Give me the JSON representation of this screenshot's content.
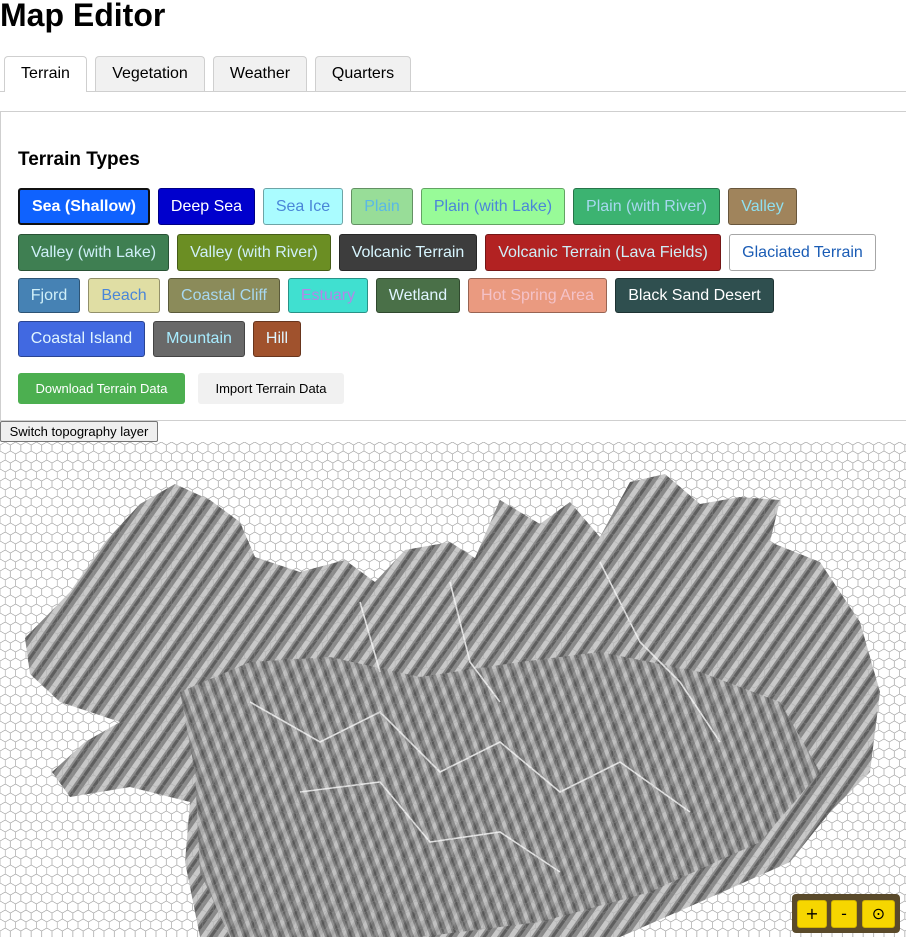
{
  "page": {
    "title": "Map Editor"
  },
  "tabs": [
    "Terrain",
    "Vegetation",
    "Weather",
    "Quarters"
  ],
  "section": {
    "title": "Terrain Types"
  },
  "terrain_types": [
    {
      "label": "Sea (Shallow)",
      "bg": "#0f62fe",
      "fg": "#ffffff",
      "selected": true
    },
    {
      "label": "Deep Sea",
      "bg": "#0000cd",
      "fg": "#ffffff"
    },
    {
      "label": "Sea Ice",
      "bg": "#aafcff",
      "fg": "#4a86d8"
    },
    {
      "label": "Plain",
      "bg": "#98dd98",
      "fg": "#5ab8e6"
    },
    {
      "label": "Plain (with Lake)",
      "bg": "#98fb98",
      "fg": "#4a86d8"
    },
    {
      "label": "Plain (with River)",
      "bg": "#3cb371",
      "fg": "#a8d8f0"
    },
    {
      "label": "Valley",
      "bg": "#a0845c",
      "fg": "#8fe0f0"
    },
    {
      "label": "Valley (with Lake)",
      "bg": "#3f7f52",
      "fg": "#cfeff8"
    },
    {
      "label": "Valley (with River)",
      "bg": "#6b8e23",
      "fg": "#cfeff8"
    },
    {
      "label": "Volcanic Terrain",
      "bg": "#3d3d3d",
      "fg": "#d8f6ff"
    },
    {
      "label": "Volcanic Terrain (Lava Fields)",
      "bg": "#b22222",
      "fg": "#cfeff8"
    },
    {
      "label": "Glaciated Terrain",
      "bg": "#ffffff",
      "fg": "#1a5cb5"
    },
    {
      "label": "Fjord",
      "bg": "#4682b4",
      "fg": "#cfeff8"
    },
    {
      "label": "Beach",
      "bg": "#e0dea4",
      "fg": "#4a86d8"
    },
    {
      "label": "Coastal Cliff",
      "bg": "#8b8b5a",
      "fg": "#a8d8f0"
    },
    {
      "label": "Estuary",
      "bg": "#40e0d0",
      "fg": "#b286e8"
    },
    {
      "label": "Wetland",
      "bg": "#4a7048",
      "fg": "#e0f5ff"
    },
    {
      "label": "Hot Spring Area",
      "bg": "#ea9a80",
      "fg": "#f4c2c8"
    },
    {
      "label": "Black Sand Desert",
      "bg": "#2f4f4f",
      "fg": "#ffffff"
    },
    {
      "label": "Coastal Island",
      "bg": "#4169e1",
      "fg": "#e0f5ff"
    },
    {
      "label": "Mountain",
      "bg": "#696969",
      "fg": "#a8ecff"
    },
    {
      "label": "Hill",
      "bg": "#a0522d",
      "fg": "#e0f5ff"
    }
  ],
  "actions": {
    "download": "Download Terrain Data",
    "import": "Import Terrain Data",
    "download_bg": "#4caf50",
    "import_bg": "#f1f1f1"
  },
  "topography": {
    "switch_label": "Switch topography layer"
  },
  "zoom": {
    "in": "+",
    "out": "-",
    "reset": "⊙"
  },
  "colors": {
    "zoom_bg": "#f6d600",
    "zoom_frame": "#5a4a2a"
  }
}
